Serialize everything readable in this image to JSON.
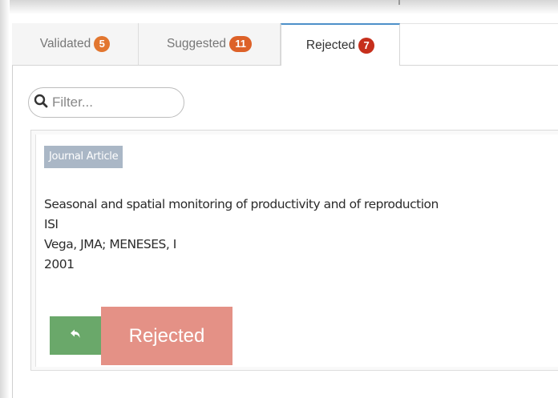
{
  "tabs": [
    {
      "label": "Validated",
      "count": "5"
    },
    {
      "label": "Suggested",
      "count": "11"
    },
    {
      "label": "Rejected",
      "count": "7"
    }
  ],
  "filter": {
    "placeholder": "Filter..."
  },
  "record": {
    "type": "Journal Article",
    "title": "Seasonal and spatial monitoring of productivity and of reproduction",
    "source": "ISI",
    "authors": "Vega, JMA; MENESES, I",
    "year": "2001"
  },
  "actions": {
    "undo_icon": "undo-arrow-icon",
    "status_label": "Rejected"
  },
  "colors": {
    "active_tab_border": "#4d90c9",
    "undo_button": "#6aa86a",
    "rejected_button": "#e49186",
    "type_label": "#aab7c6"
  }
}
